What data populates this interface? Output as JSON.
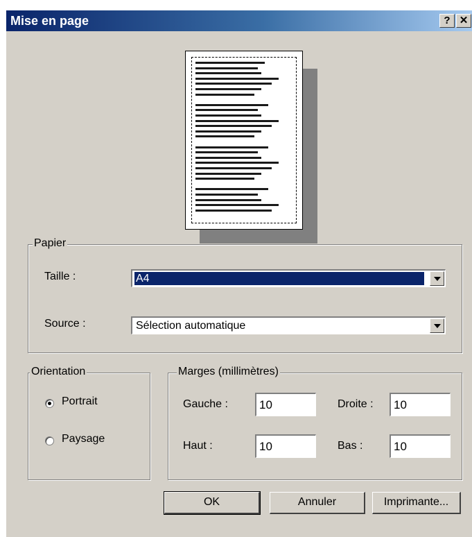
{
  "window": {
    "title": "Mise en page",
    "help_label": "?",
    "close_label": "✕"
  },
  "paper": {
    "group_label": "Papier",
    "size_label": "Taille :",
    "size_value": "A4",
    "source_label": "Source :",
    "source_value": "Sélection automatique"
  },
  "orientation": {
    "group_label": "Orientation",
    "options": [
      {
        "label": "Portrait",
        "checked": true
      },
      {
        "label": "Paysage",
        "checked": false
      }
    ]
  },
  "margins": {
    "group_label": "Marges (millimètres)",
    "left_label": "Gauche :",
    "left_value": "10",
    "right_label": "Droite :",
    "right_value": "10",
    "top_label": "Haut :",
    "top_value": "10",
    "bottom_label": "Bas :",
    "bottom_value": "10"
  },
  "buttons": {
    "ok": "OK",
    "cancel": "Annuler",
    "printer": "Imprimante..."
  },
  "colors": {
    "face": "#d4d0c8",
    "title_start": "#0a246a",
    "selection": "#0a246a"
  },
  "icons": {
    "help": "question-icon",
    "close": "close-icon",
    "dropdown": "chevron-down-icon"
  }
}
